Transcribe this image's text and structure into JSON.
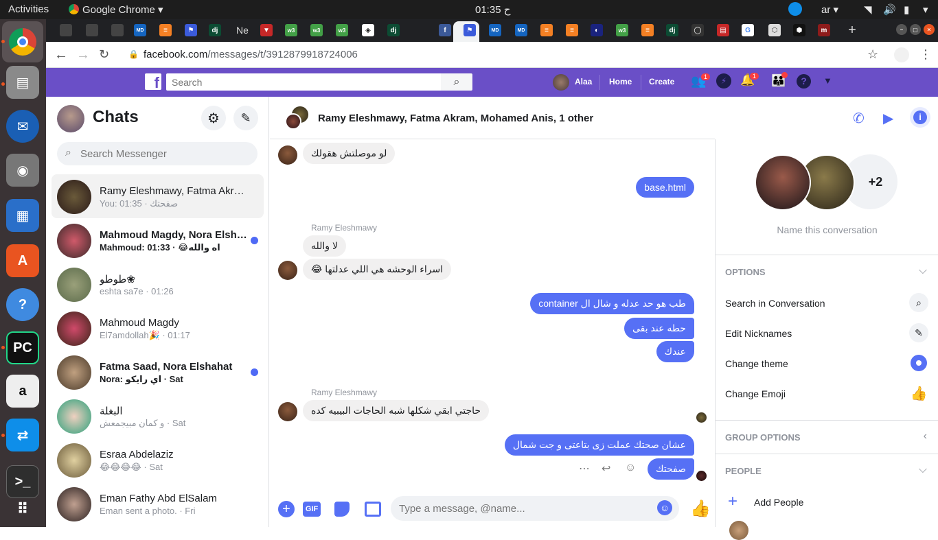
{
  "topbar": {
    "activities": "Activities",
    "app": "Google Chrome",
    "clock": "ح 01:35",
    "lang": "ar"
  },
  "browser": {
    "url_host": "facebook.com",
    "url_path": "/messages/t/3912879918724006",
    "new_tab": "Ne"
  },
  "fb": {
    "search_placeholder": "Search",
    "user": "Alaa",
    "home": "Home",
    "create": "Create",
    "friend_badge": "1",
    "notif_badge": "1"
  },
  "left": {
    "title": "Chats",
    "search_placeholder": "Search Messenger",
    "chats": [
      {
        "name": "Ramy Eleshmawy, Fatma Akr…",
        "sub": "You: صفحتك · 01:35",
        "bold": false,
        "unread": false
      },
      {
        "name": "Mahmoud Magdy, Nora Elsh…",
        "sub": "Mahmoud: اه والله😂 · 01:33",
        "bold": true,
        "unread": true
      },
      {
        "name": "طوطو❀",
        "sub": "eshta sa7e · 01:26",
        "bold": false,
        "unread": false
      },
      {
        "name": "Mahmoud Magdy",
        "sub": "El7amdollah🎉 · 01:17",
        "bold": false,
        "unread": false
      },
      {
        "name": "Fatma Saad, Nora Elshahat",
        "sub": "Nora: اي رايكو · Sat",
        "bold": true,
        "unread": true
      },
      {
        "name": "البغلة",
        "sub": "و كمان مبيجمعش · Sat",
        "bold": false,
        "unread": false
      },
      {
        "name": "Esraa Abdelaziz",
        "sub": "😂😂😂😂 · Sat",
        "bold": false,
        "unread": false
      },
      {
        "name": "Eman Fathy Abd ElSalam",
        "sub": "Eman sent a photo. · Fri",
        "bold": false,
        "unread": false
      }
    ]
  },
  "conversation": {
    "title": "Ramy Eleshmawy, Fatma Akram, Mohamed Anis, 1 other",
    "sender": "Ramy Eleshmawy",
    "messages": {
      "m1": "لو موصلتش هقولك",
      "m2": "base.html",
      "m3": "لا والله",
      "m4": "اسراء الوحشه هي اللي عدلتها 😂",
      "m5": "طب هو حد عدله و شال ال container",
      "m6": "حطه عند بقى",
      "m7": "عندك",
      "m8": "حاجتي ابقي شكلها شبه الحاجات البيبيه كده",
      "m9": "عشان صحتك عملت زى بتاعتى و جت شمال",
      "m10": "صفحتك"
    },
    "composer_placeholder": "Type a message, @name...",
    "gif": "GIF"
  },
  "right": {
    "plus_count": "+2",
    "name_conv": "Name this conversation",
    "options": "OPTIONS",
    "search_conv": "Search in Conversation",
    "edit_nick": "Edit Nicknames",
    "change_theme": "Change theme",
    "change_emoji": "Change Emoji",
    "group_options": "GROUP OPTIONS",
    "people": "PEOPLE",
    "add_people": "Add People"
  },
  "colors": {
    "accent": "#5670f5",
    "fb_bar": "#6a4fc7"
  }
}
